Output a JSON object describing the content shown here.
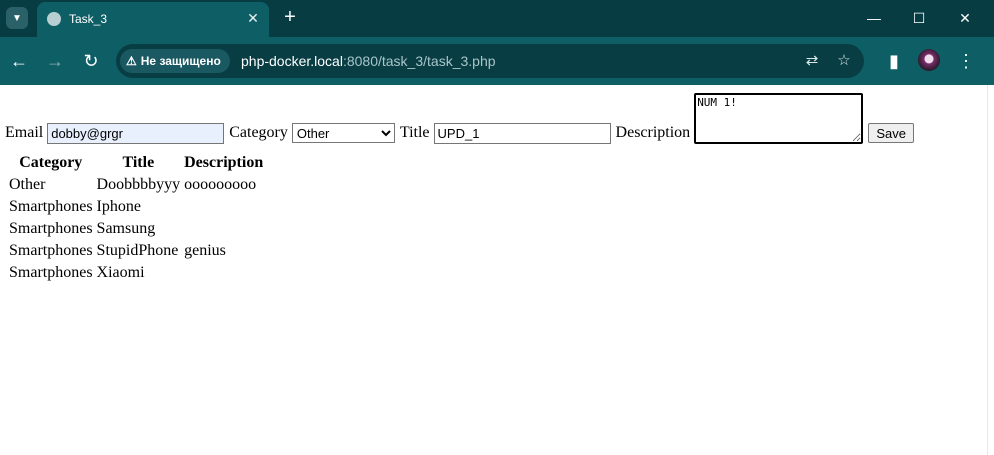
{
  "browser": {
    "tab_title": "Task_3",
    "security_label": "Не защищено",
    "url_host": "php-docker.local",
    "url_rest": ":8080/task_3/task_3.php"
  },
  "form": {
    "email_label": "Email",
    "email_value": "dobby@grgr",
    "category_label": "Category",
    "category_selected": "Other",
    "title_label": "Title",
    "title_value": "UPD_1",
    "description_label": "Description",
    "description_value": "NUM 1!",
    "save_label": "Save"
  },
  "table": {
    "headers": [
      "Category",
      "Title",
      "Description"
    ],
    "rows": [
      [
        "Other",
        "Doobbbbyyy",
        "ooooooooo"
      ],
      [
        "Smartphones",
        "Iphone",
        ""
      ],
      [
        "Smartphones",
        "Samsung",
        ""
      ],
      [
        "Smartphones",
        "StupidPhone",
        "genius"
      ],
      [
        "Smartphones",
        "Xiaomi",
        ""
      ]
    ]
  },
  "colors": {
    "tabstrip": "#063c42",
    "toolbar": "#0e5e66",
    "omnibox": "#073d43"
  }
}
